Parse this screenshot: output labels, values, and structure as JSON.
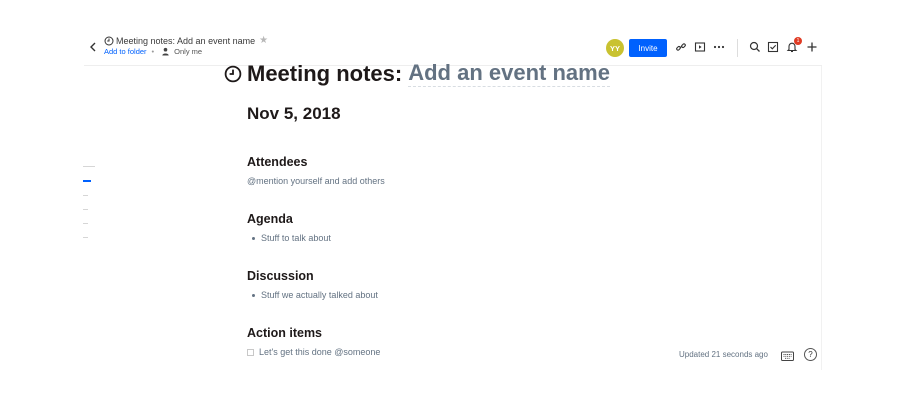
{
  "header": {
    "doc_title": "Meeting notes: Add an event name",
    "add_to_folder": "Add to folder",
    "separator": "•",
    "sharing": "Only me",
    "avatar_initials": "YY",
    "invite_label": "Invite",
    "notification_count": "1"
  },
  "document": {
    "title_prefix": "Meeting notes:",
    "title_placeholder": "Add an event name",
    "date": "Nov 5, 2018",
    "sections": [
      {
        "heading": "Attendees",
        "text": "@mention yourself and add others"
      },
      {
        "heading": "Agenda",
        "text": "Stuff to talk about"
      },
      {
        "heading": "Discussion",
        "text": "Stuff we actually talked about"
      },
      {
        "heading": "Action items",
        "text": "Let's get this done @someone"
      }
    ]
  },
  "footer": {
    "status": "Updated 21 seconds ago",
    "help_label": "?"
  },
  "colors": {
    "accent": "#0061fe",
    "avatar": "#c9c230",
    "badge": "#e03b24",
    "placeholder_text": "#637282"
  },
  "icons": [
    "back-chevron-icon",
    "clock-icon",
    "star-icon",
    "person-icon",
    "link-icon",
    "present-icon",
    "more-icon",
    "search-icon",
    "tasks-icon",
    "bell-icon",
    "plus-icon",
    "keyboard-icon",
    "help-icon"
  ]
}
